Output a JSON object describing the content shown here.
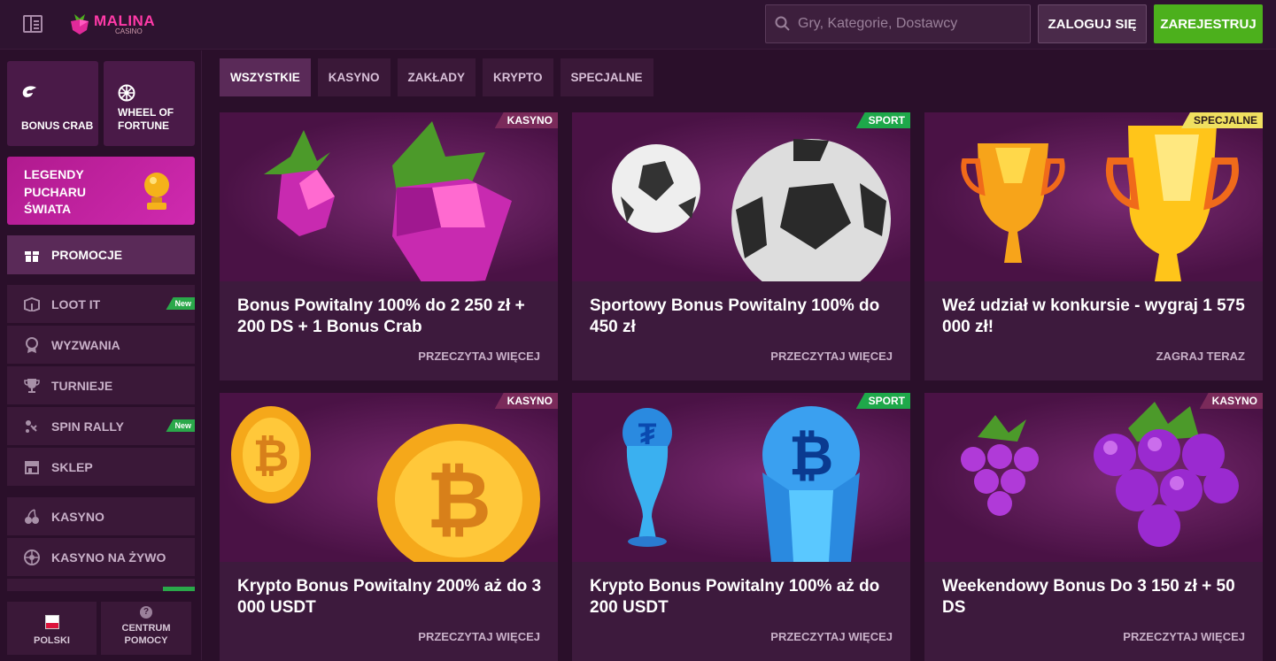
{
  "header": {
    "logo_text": "MALINA",
    "logo_sub": "CASINO",
    "search_placeholder": "Gry, Kategorie, Dostawcy",
    "login_label": "ZALOGUJ SIĘ",
    "register_label": "ZAREJESTRUJ"
  },
  "sidebar": {
    "tiles": [
      {
        "label": "BONUS CRAB",
        "icon": "crab-claw-icon"
      },
      {
        "label": "WHEEL OF FORTUNE",
        "icon": "wheel-icon"
      }
    ],
    "legend_label": "LEGENDY PUCHARU ŚWIATA",
    "items": [
      {
        "label": "PROMOCJE",
        "icon": "gift-icon",
        "active": true
      },
      {
        "label": "LOOT IT",
        "icon": "box-icon",
        "badge": "New"
      },
      {
        "label": "WYZWANIA",
        "icon": "medal-icon"
      },
      {
        "label": "TURNIEJE",
        "icon": "trophy-icon"
      },
      {
        "label": "SPIN RALLY",
        "icon": "rally-icon",
        "badge": "New"
      },
      {
        "label": "SKLEP",
        "icon": "shop-icon"
      },
      {
        "label": "KASYNO",
        "icon": "cherries-icon"
      },
      {
        "label": "KASYNO NA ŻYWO",
        "icon": "roulette-icon"
      }
    ],
    "bottom": {
      "language": "POLSKI",
      "help": "CENTRUM POMOCY"
    }
  },
  "tabs": [
    "WSZYSTKIE",
    "KASYNO",
    "ZAKŁADY",
    "KRYPTO",
    "SPECJALNE"
  ],
  "cards": [
    {
      "category": "KASYNO",
      "title": "Bonus Powitalny 100% do 2 250 zł + 200 DS + 1 Bonus Crab",
      "action": "PRZECZYTAJ WIĘCEJ",
      "art": "raspberry"
    },
    {
      "category": "SPORT",
      "title": "Sportowy Bonus Powitalny 100% do 450 zł",
      "action": "PRZECZYTAJ WIĘCEJ",
      "art": "football"
    },
    {
      "category": "SPECJALNE",
      "title": "Weź udział w konkursie - wygraj 1 575 000 zł!",
      "action": "ZAGRAJ TERAZ",
      "art": "trophy"
    },
    {
      "category": "KASYNO",
      "title": "Krypto Bonus Powitalny 200% aż do 3 000 USDT",
      "action": "PRZECZYTAJ WIĘCEJ",
      "art": "btc-coin"
    },
    {
      "category": "SPORT",
      "title": "Krypto Bonus Powitalny 100% aż do 200 USDT",
      "action": "PRZECZYTAJ WIĘCEJ",
      "art": "crypto-trophy"
    },
    {
      "category": "KASYNO",
      "title": "Weekendowy Bonus Do 3 150 zł + 50 DS",
      "action": "PRZECZYTAJ WIĘCEJ",
      "art": "grapes"
    }
  ],
  "colors": {
    "accent_green": "#4cb01c",
    "brand_pink": "#ff3aa8",
    "bg": "#2a0f2a"
  }
}
